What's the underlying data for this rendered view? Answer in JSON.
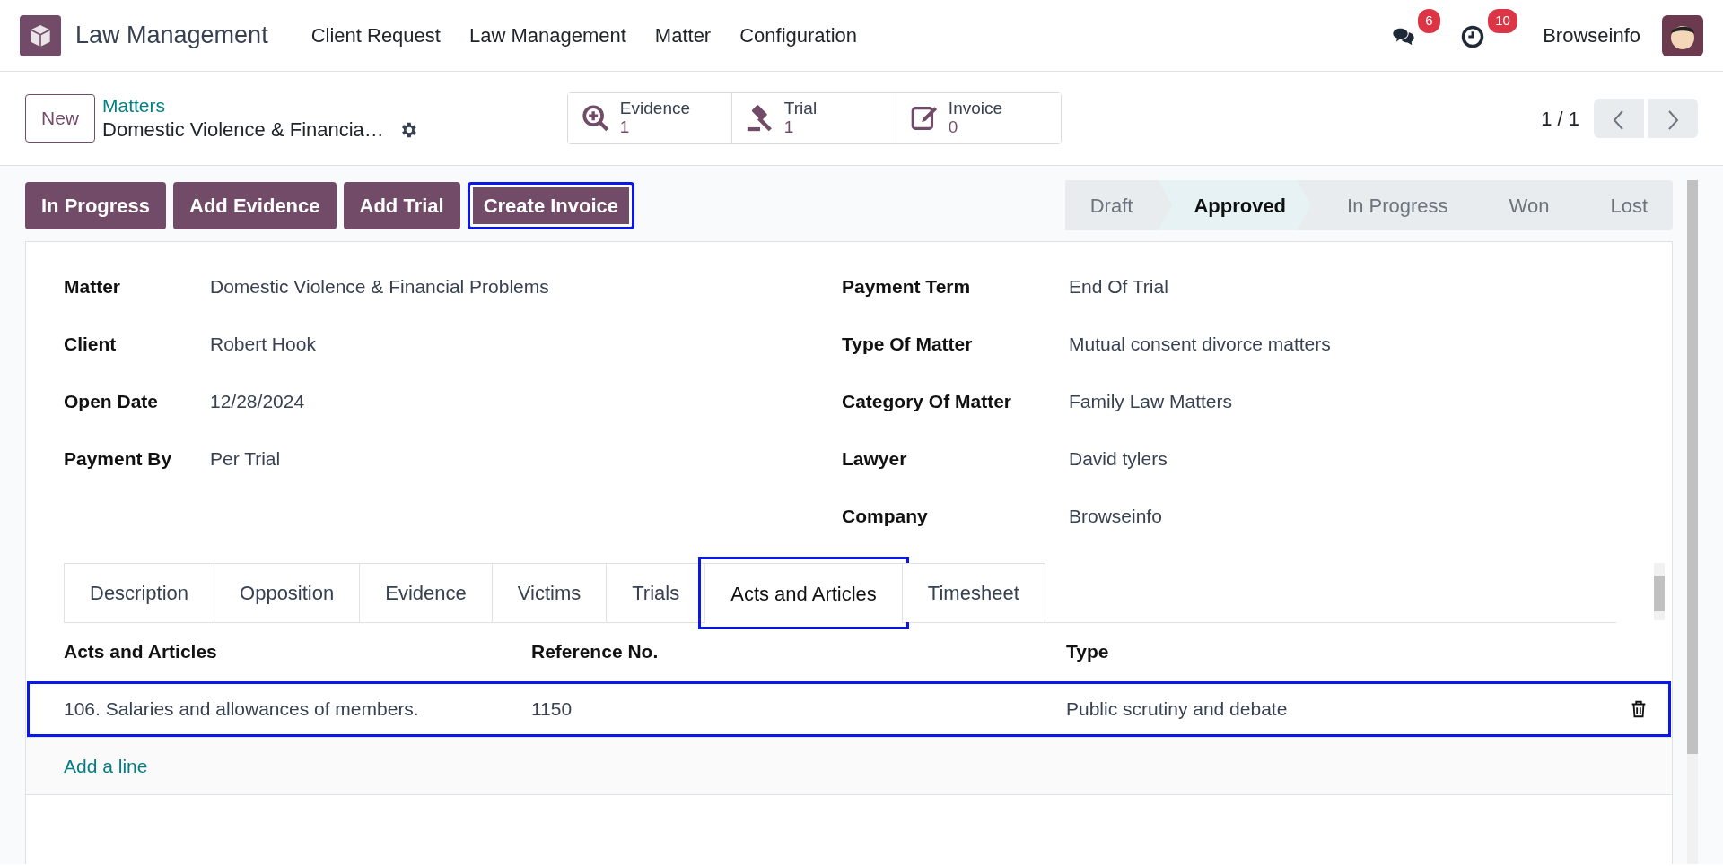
{
  "navbar": {
    "app_name": "Law Management",
    "menu": [
      "Client Request",
      "Law Management",
      "Matter",
      "Configuration"
    ],
    "messages_count": "6",
    "activities_count": "10",
    "company": "Browseinfo"
  },
  "control_panel": {
    "new_button": "New",
    "breadcrumb": "Matters",
    "record_title": "Domestic Violence & Financia…",
    "smart_buttons": [
      {
        "kind": "evidence",
        "label": "Evidence",
        "count": "1"
      },
      {
        "kind": "trial",
        "label": "Trial",
        "count": "1"
      },
      {
        "kind": "invoice",
        "label": "Invoice",
        "count": "0"
      }
    ],
    "pager": "1 / 1"
  },
  "actions": [
    {
      "label": "In Progress",
      "highlighted": false
    },
    {
      "label": "Add Evidence",
      "highlighted": false
    },
    {
      "label": "Add Trial",
      "highlighted": false
    },
    {
      "label": "Create Invoice",
      "highlighted": true
    }
  ],
  "stages": [
    {
      "label": "Draft",
      "selected": false
    },
    {
      "label": "Approved",
      "selected": true
    },
    {
      "label": "In Progress",
      "selected": false
    },
    {
      "label": "Won",
      "selected": false
    },
    {
      "label": "Lost",
      "selected": false
    }
  ],
  "fields_left": [
    {
      "label": "Matter",
      "value": "Domestic Violence & Financial Problems"
    },
    {
      "label": "Client",
      "value": "Robert Hook"
    },
    {
      "label": "Open Date",
      "value": "12/28/2024"
    },
    {
      "label": "Payment By",
      "value": "Per Trial"
    }
  ],
  "fields_right": [
    {
      "label": "Payment Term",
      "value": "End Of Trial"
    },
    {
      "label": "Type Of Matter",
      "value": "Mutual consent divorce matters"
    },
    {
      "label": "Category Of Matter",
      "value": "Family Law Matters"
    },
    {
      "label": "Lawyer",
      "value": "David tylers"
    },
    {
      "label": "Company",
      "value": "Browseinfo"
    }
  ],
  "tabs": [
    {
      "label": "Description",
      "selected": false,
      "highlighted": false
    },
    {
      "label": "Opposition",
      "selected": false,
      "highlighted": false
    },
    {
      "label": "Evidence",
      "selected": false,
      "highlighted": false
    },
    {
      "label": "Victims",
      "selected": false,
      "highlighted": false
    },
    {
      "label": "Trials",
      "selected": false,
      "highlighted": false
    },
    {
      "label": "Acts and Articles",
      "selected": true,
      "highlighted": true
    },
    {
      "label": "Timesheet",
      "selected": false,
      "highlighted": false
    }
  ],
  "table": {
    "columns": [
      "Acts and Articles",
      "Reference No.",
      "Type"
    ],
    "rows": [
      {
        "cells": [
          "106. Salaries and allowances of members.",
          "1150",
          "Public scrutiny and debate"
        ],
        "highlighted": true
      }
    ],
    "add_line": "Add a line"
  }
}
